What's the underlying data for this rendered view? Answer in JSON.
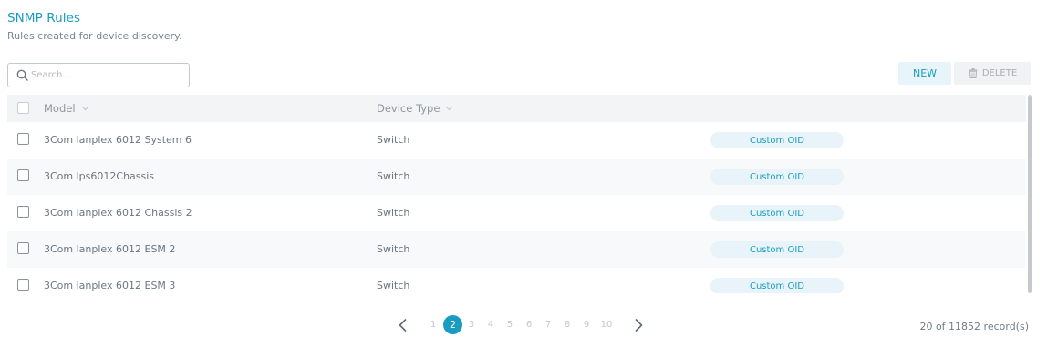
{
  "header": {
    "title": "SNMP Rules",
    "subtitle": "Rules created for device discovery."
  },
  "search": {
    "placeholder": "Search...",
    "value": ""
  },
  "toolbar": {
    "new_label": "NEW",
    "delete_label": "DELETE"
  },
  "table": {
    "columns": [
      "Model",
      "Device Type"
    ],
    "rows": [
      {
        "model": "3Com lanplex 6012 System 6",
        "device_type": "Switch",
        "tag": "Custom OID"
      },
      {
        "model": "3Com lps6012Chassis",
        "device_type": "Switch",
        "tag": "Custom OID"
      },
      {
        "model": "3Com lanplex 6012 Chassis 2",
        "device_type": "Switch",
        "tag": "Custom OID"
      },
      {
        "model": "3Com lanplex 6012 ESM 2",
        "device_type": "Switch",
        "tag": "Custom OID"
      },
      {
        "model": "3Com lanplex 6012 ESM 3",
        "device_type": "Switch",
        "tag": "Custom OID"
      }
    ]
  },
  "pagination": {
    "pages": [
      "1",
      "2",
      "3",
      "4",
      "5",
      "6",
      "7",
      "8",
      "9",
      "10"
    ],
    "current": "2",
    "records": "20 of 11852 record(s)"
  },
  "colors": {
    "accent": "#1a9cc0",
    "badge_bg": "#e8f4f9"
  }
}
